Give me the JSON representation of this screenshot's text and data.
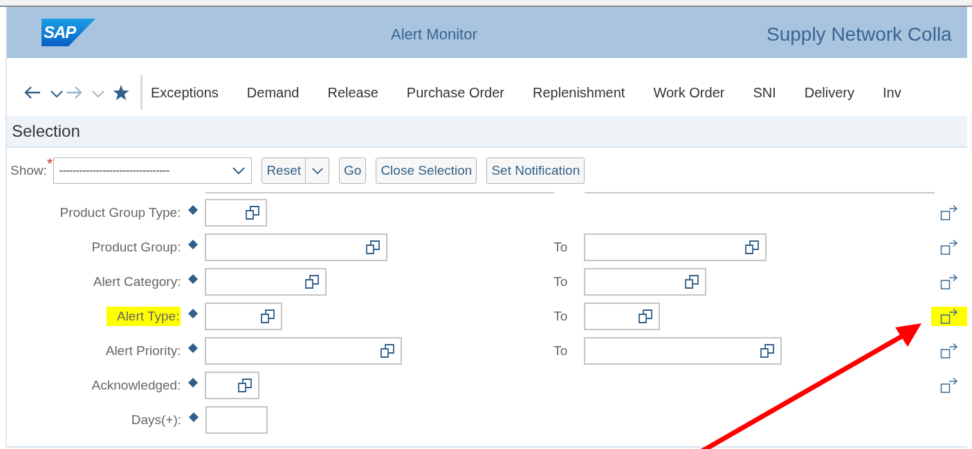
{
  "header": {
    "logo": "SAP",
    "title": "Alert Monitor",
    "app_title": "Supply Network Colla"
  },
  "nav": {
    "back_enabled": true,
    "forward_enabled": false
  },
  "menu": [
    {
      "label": "Exceptions"
    },
    {
      "label": "Demand"
    },
    {
      "label": "Release"
    },
    {
      "label": "Purchase Order"
    },
    {
      "label": "Replenishment"
    },
    {
      "label": "Work Order"
    },
    {
      "label": "SNI"
    },
    {
      "label": "Delivery"
    },
    {
      "label": "Inv"
    }
  ],
  "section_title": "Selection",
  "show": {
    "label": "Show:",
    "required_mark": "*",
    "value": "---------------------------------"
  },
  "buttons": [
    {
      "label": "Reset",
      "kind": "split"
    },
    {
      "label": "Go",
      "kind": "plain"
    },
    {
      "label": "Close Selection",
      "kind": "plain"
    },
    {
      "label": "Set Notification",
      "kind": "plain"
    }
  ],
  "rows": [
    {
      "label": "Product Group Type:",
      "value_help": true,
      "to_label": null,
      "multiple_selection": true,
      "highlighted": false,
      "icon_highlighted": false
    },
    {
      "label": "Product Group:",
      "value_help": true,
      "to_label": "To",
      "multiple_selection": true,
      "highlighted": false,
      "icon_highlighted": false
    },
    {
      "label": "Alert Category:",
      "value_help": true,
      "to_label": "To",
      "multiple_selection": true,
      "highlighted": false,
      "icon_highlighted": false
    },
    {
      "label": "Alert Type:",
      "value_help": true,
      "to_label": "To",
      "multiple_selection": true,
      "highlighted": true,
      "icon_highlighted": true
    },
    {
      "label": "Alert Priority:",
      "value_help": true,
      "to_label": "To",
      "multiple_selection": true,
      "highlighted": false,
      "icon_highlighted": false
    },
    {
      "label": "Acknowledged:",
      "value_help": true,
      "to_label": null,
      "multiple_selection": true,
      "highlighted": false,
      "icon_highlighted": false
    },
    {
      "label": "Days(+):",
      "value_help": false,
      "to_label": null,
      "multiple_selection": false,
      "highlighted": false
    }
  ]
}
